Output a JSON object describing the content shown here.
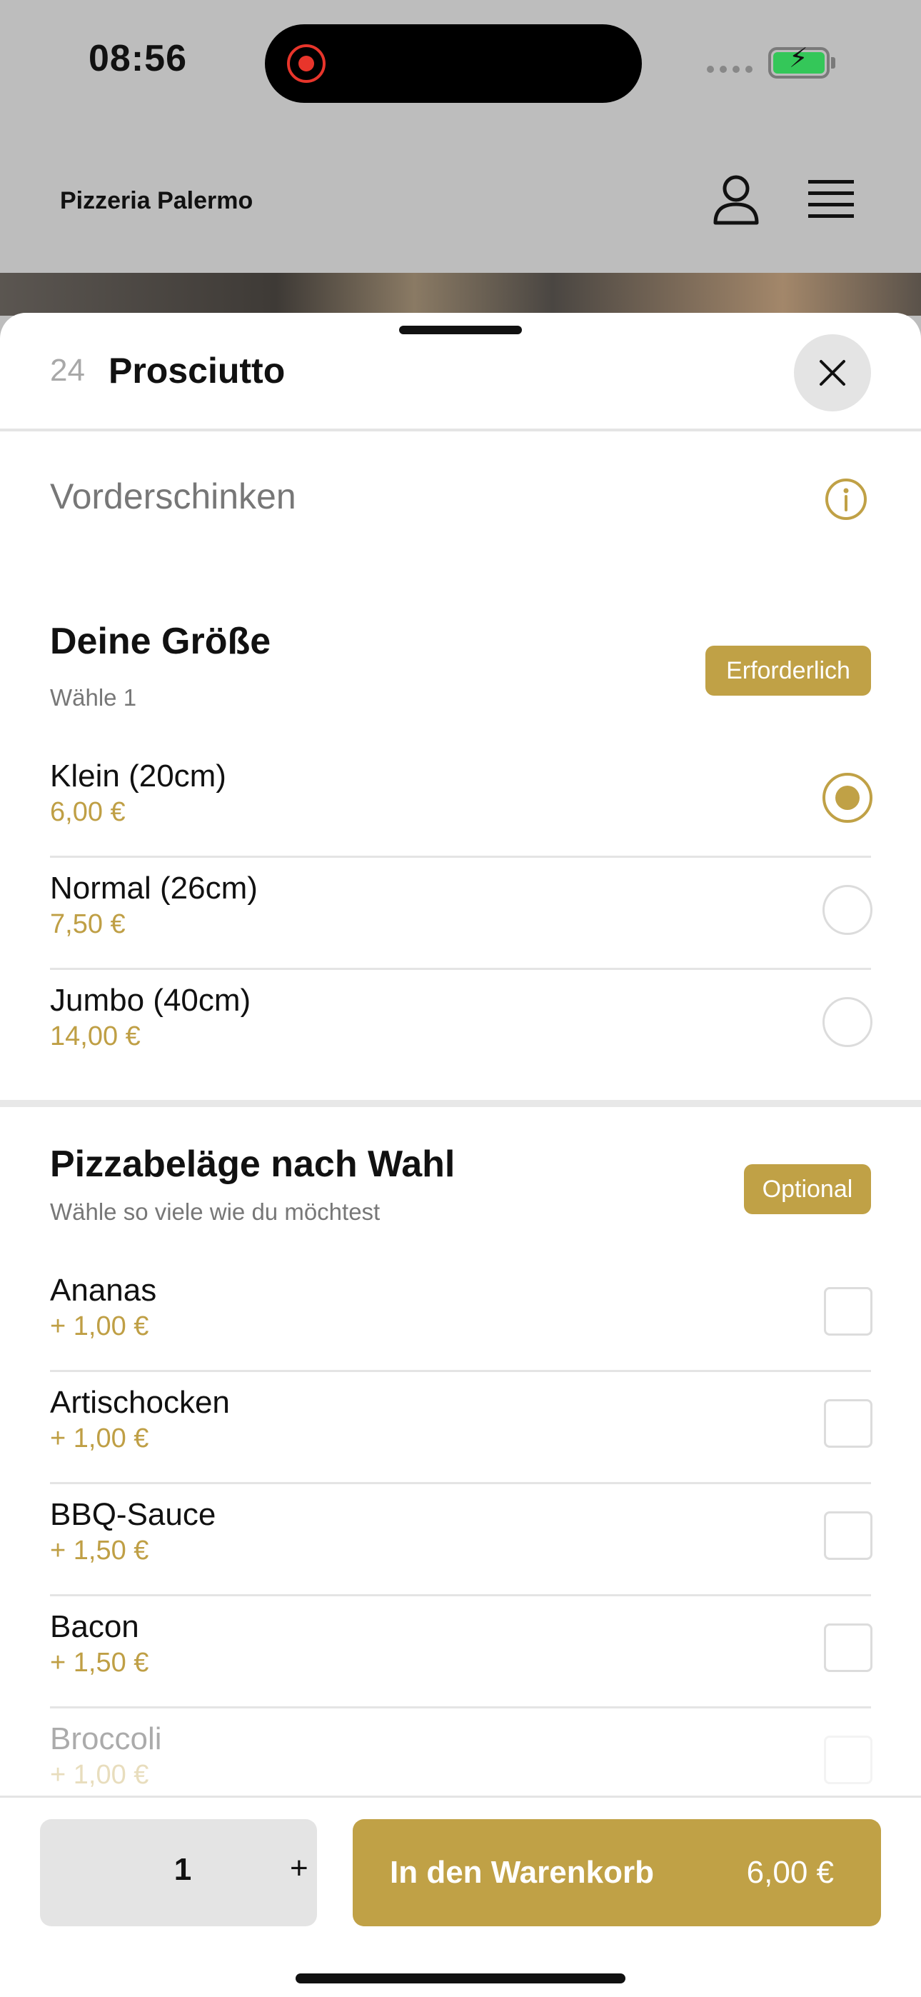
{
  "status_bar": {
    "time": "08:56"
  },
  "header": {
    "brand": "Pizzeria Palermo"
  },
  "item": {
    "number": "24",
    "name": "Prosciutto",
    "description": "Vorderschinken"
  },
  "size_section": {
    "title": "Deine Größe",
    "subtitle": "Wähle 1",
    "badge": "Erforderlich",
    "options": [
      {
        "label": "Klein (20cm)",
        "price": "6,00 €",
        "selected": true
      },
      {
        "label": "Normal (26cm)",
        "price": "7,50 €",
        "selected": false
      },
      {
        "label": "Jumbo (40cm)",
        "price": "14,00 €",
        "selected": false
      }
    ]
  },
  "toppings_section": {
    "title": "Pizzabeläge nach Wahl",
    "subtitle": "Wähle so viele wie du möchtest",
    "badge": "Optional",
    "options": [
      {
        "label": "Ananas",
        "price": "+ 1,00 €"
      },
      {
        "label": "Artischocken",
        "price": "+ 1,00 €"
      },
      {
        "label": "BBQ-Sauce",
        "price": "+ 1,50 €"
      },
      {
        "label": "Bacon",
        "price": "+ 1,50 €"
      },
      {
        "label": "Broccoli",
        "price": "+ 1,00 €"
      }
    ]
  },
  "footer": {
    "quantity": "1",
    "plus": "+",
    "cart_label": "In den Warenkorb",
    "cart_price": "6,00 €"
  },
  "colors": {
    "accent": "#c0a146",
    "overlay": "#bdbdbd"
  }
}
